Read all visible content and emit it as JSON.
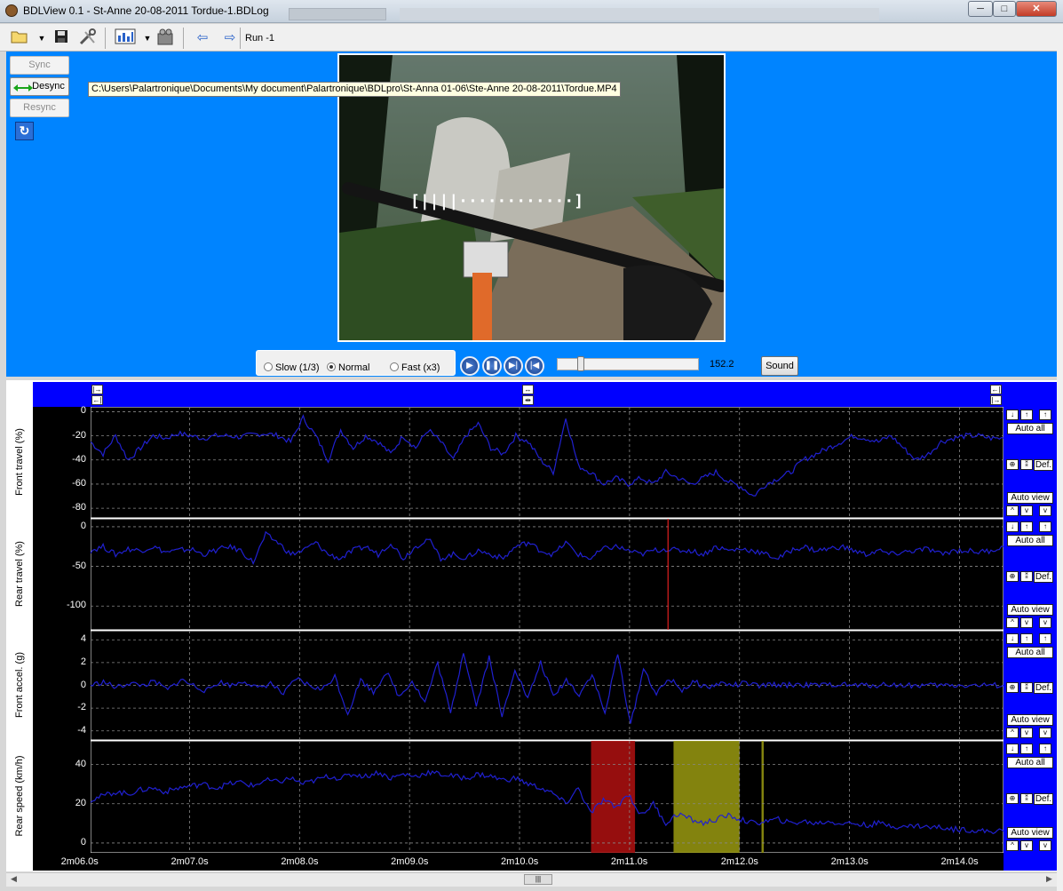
{
  "window": {
    "title": "BDLView 0.1 - St-Anne 20-08-2011 Tordue-1.BDLog",
    "min": "─",
    "max": "□",
    "close": "✕"
  },
  "toolbar": {
    "run_label": "Run -1",
    "icons": [
      "open-folder-icon",
      "save-icon",
      "tools-icon",
      "chart-icon",
      "camera-icon",
      "arrow-left-icon",
      "arrow-right-icon"
    ]
  },
  "sync": {
    "sync_label": "Sync",
    "desync_label": "Desync",
    "resync_label": "Resync"
  },
  "video": {
    "tooltip": "C:\\Users\\Palartronique\\Documents\\My document\\Palartronique\\BDLpro\\St-Anna 01-06\\Ste-Anne 20-08-2011\\Tordue.MP4",
    "position": "152.2",
    "sound_label": "Sound",
    "speeds": [
      {
        "label": "Slow (1/3)",
        "selected": false
      },
      {
        "label": "Normal",
        "selected": true
      },
      {
        "label": "Fast (x3)",
        "selected": false
      }
    ],
    "slider_fraction": 0.15
  },
  "side_controls": {
    "auto_all": "Auto all",
    "def": "Def.",
    "auto_view": "Auto view"
  },
  "colors": {
    "trace": "#2020d0",
    "panel_blue": "#0084ff",
    "nav_blue": "#0000ff",
    "highlight_red": "#b01010",
    "highlight_yellow": "#9a9a10"
  },
  "chart_data": [
    {
      "type": "line",
      "ylabel": "Front travel (%)",
      "yticks": [
        "0",
        "-20",
        "-40",
        "-60",
        "-80"
      ],
      "ylim": [
        -88,
        4
      ],
      "xlim": [
        126.1,
        134.4
      ],
      "y": [
        -25,
        -35,
        -20,
        -40,
        -30,
        -20,
        -22,
        -18,
        -20,
        -22,
        -20,
        -20,
        -21,
        -19,
        -18,
        -20,
        -25,
        -5,
        -20,
        -40,
        -15,
        -30,
        -20,
        -25,
        -35,
        -20,
        -30,
        -15,
        -25,
        -40,
        -20,
        -10,
        -30,
        -35,
        -20,
        -25,
        -40,
        -50,
        -5,
        -45,
        -50,
        -60,
        -55,
        -60,
        -55,
        -60,
        -50,
        -55,
        -60,
        -55,
        -50,
        -58,
        -62,
        -70,
        -60,
        -55,
        -50,
        -40,
        -35,
        -30,
        -25,
        -20,
        -22,
        -25,
        -20,
        -30,
        -40,
        -35,
        -25,
        -22,
        -20,
        -20,
        -22,
        -22
      ]
    },
    {
      "type": "line",
      "ylabel": "Rear travel (%)",
      "yticks": [
        "0",
        "-50",
        "-100"
      ],
      "ylim": [
        -130,
        10
      ],
      "xlim": [
        126.1,
        134.4
      ],
      "y": [
        -30,
        -25,
        -35,
        -28,
        -30,
        -25,
        -32,
        -30,
        -28,
        -35,
        -30,
        -25,
        -30,
        -45,
        -10,
        -20,
        -35,
        -30,
        -20,
        -35,
        -40,
        -30,
        -25,
        -35,
        -20,
        -40,
        -25,
        -15,
        -40,
        -35,
        -40,
        -30,
        -35,
        -40,
        -25,
        -20,
        -30,
        -35,
        -20,
        -35,
        -40,
        -28,
        -25,
        -30,
        -35,
        -30,
        -28,
        -30,
        -30,
        -35,
        -25,
        -30,
        -28,
        -30,
        -35,
        -40,
        -30,
        -25,
        -30,
        -28,
        -25,
        -30,
        -35,
        -30,
        -35,
        -32,
        -30,
        -28,
        -35,
        -30,
        -30,
        -32,
        -30,
        -25
      ]
    },
    {
      "type": "line",
      "ylabel": "Front accel. (g)",
      "yticks": [
        "4",
        "2",
        "0",
        "-2",
        "-4"
      ],
      "ylim": [
        -4.8,
        4.8
      ],
      "xlim": [
        126.1,
        134.4
      ],
      "y": [
        0,
        0.3,
        -0.2,
        0.2,
        0,
        0.3,
        -0.4,
        0.5,
        0,
        -0.5,
        0.3,
        0,
        0.4,
        -0.3,
        0.2,
        -0.8,
        0.6,
        0,
        -0.4,
        0.8,
        -2.5,
        0.5,
        -0.6,
        1.2,
        -1,
        0.4,
        -1.5,
        2,
        -2.5,
        3,
        -1.8,
        2.5,
        -2.8,
        1.5,
        -1.2,
        2,
        -1,
        0.5,
        -0.8,
        1,
        -2.5,
        2.8,
        -3.5,
        1.5,
        -0.8,
        0.6,
        -0.4,
        0.3,
        -0.2,
        0.2,
        0,
        0.2,
        -0.1,
        0.1,
        0,
        0.1,
        0,
        0,
        0.1,
        0,
        0,
        0,
        0.1,
        0,
        0,
        0,
        0,
        0,
        0,
        0,
        0,
        0
      ]
    },
    {
      "type": "line",
      "ylabel": "Rear speed (km/h)",
      "yticks": [
        "40",
        "20",
        "0"
      ],
      "ylim": [
        -5,
        52
      ],
      "xlim": [
        126.1,
        134.4
      ],
      "xticks": [
        "2m06.0s",
        "2m07.0s",
        "2m08.0s",
        "2m09.0s",
        "2m10.0s",
        "2m11.0s",
        "2m12.0s",
        "2m13.0s",
        "2m14.0s"
      ],
      "highlights": [
        {
          "from": 130.65,
          "to": 131.05,
          "color": "red"
        },
        {
          "from": 131.4,
          "to": 132.0,
          "color": "yellow"
        },
        {
          "from": 132.2,
          "to": 132.22,
          "color": "yellow"
        }
      ],
      "y": [
        22,
        24,
        26,
        25,
        27,
        28,
        26,
        28,
        29,
        30,
        28,
        30,
        31,
        29,
        32,
        31,
        33,
        30,
        32,
        34,
        33,
        35,
        34,
        36,
        33,
        35,
        34,
        36,
        35,
        34,
        33,
        35,
        34,
        32,
        33,
        30,
        28,
        25,
        20,
        28,
        15,
        22,
        18,
        25,
        14,
        20,
        10,
        15,
        12,
        10,
        12,
        14,
        12,
        10,
        11,
        12,
        10,
        11,
        10,
        11,
        10,
        10,
        9,
        10,
        9,
        8,
        9,
        8,
        8,
        7,
        7,
        6,
        6,
        6
      ]
    }
  ]
}
